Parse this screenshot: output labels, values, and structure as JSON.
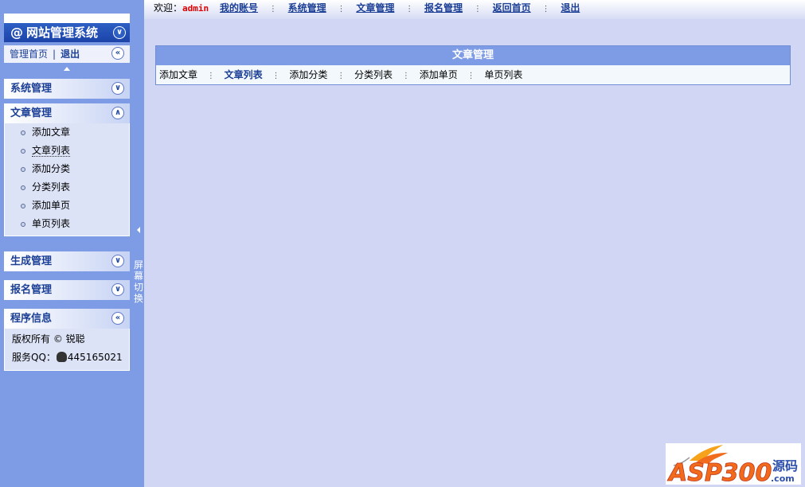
{
  "sidebar": {
    "title": "网站管理系统",
    "title_prefix": "@",
    "links": {
      "home": "管理首页",
      "separator": "|",
      "logout": "退出"
    },
    "panels": {
      "system": "系统管理",
      "article": "文章管理",
      "generate": "生成管理",
      "signup": "报名管理",
      "info": "程序信息"
    },
    "article_items": [
      "添加文章",
      "文章列表",
      "添加分类",
      "分类列表",
      "添加单页",
      "单页列表"
    ],
    "info": {
      "copyright": "版权所有 © 锐聪",
      "qq_label": "服务QQ：",
      "qq_number": "445165021"
    }
  },
  "splitter": {
    "label": "屏幕切换"
  },
  "topbar": {
    "welcome": "欢迎：",
    "user": "admin",
    "nav": [
      "我的账号",
      "系统管理",
      "文章管理",
      "报名管理",
      "返回首页",
      "退出"
    ]
  },
  "main": {
    "title": "文章管理",
    "links": [
      "添加文章",
      "文章列表",
      "添加分类",
      "分类列表",
      "添加单页",
      "单页列表"
    ]
  },
  "logo": {
    "brand": "ASP300",
    "tag": "源码",
    "domain": ".com"
  },
  "colors": {
    "sidebar_bg": "#7e9ce6",
    "content_bg": "#d0d6f4",
    "title_blue": "#1c43a8",
    "link_blue": "#1c3f96",
    "user_red": "#e00000",
    "logo_orange": "#f26a1b"
  }
}
